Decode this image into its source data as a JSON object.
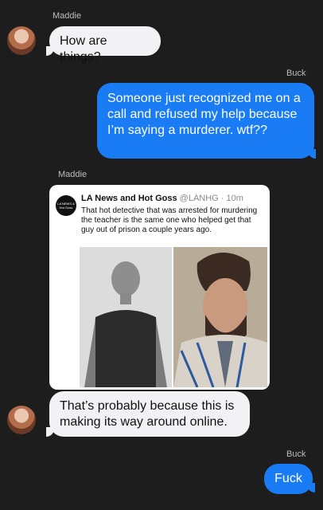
{
  "messages": [
    {
      "sender": "Maddie",
      "text": "How are things?"
    },
    {
      "sender": "Buck",
      "text": "Someone just recognized me on a call and refused my help because I’m saying a murderer. wtf??"
    },
    {
      "sender": "Maddie"
    },
    {
      "text": "That’s probably because this is making its way around online."
    },
    {
      "sender": "Buck",
      "text": "Fuck"
    }
  ],
  "tweet": {
    "avatar_text": "LA NEWS & Hot Goss",
    "name": "LA News and Hot Goss",
    "meta": "@LANHG · 10m",
    "text": "That hot detective that was arrested for murdering the teacher is the same one who helped get that guy out of prison a couple years ago."
  },
  "colors": {
    "background": "#1d1d1e",
    "incoming": "#f2f2f5",
    "outgoing": "#1a7cf5"
  }
}
